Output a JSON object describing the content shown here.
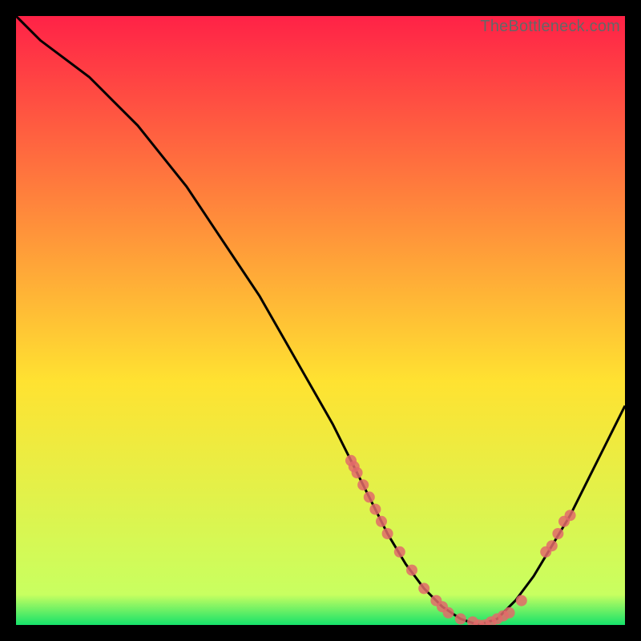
{
  "watermark": "TheBottleneck.com",
  "colors": {
    "bg": "#000000",
    "gradient_top": "#ff2247",
    "gradient_mid": "#ffe231",
    "gradient_bottom": "#16e26a",
    "curve": "#000000",
    "marker": "#e26a6a"
  },
  "chart_data": {
    "type": "line",
    "title": "",
    "xlabel": "",
    "ylabel": "",
    "xlim": [
      0,
      100
    ],
    "ylim": [
      0,
      100
    ],
    "curve": {
      "x": [
        0,
        4,
        8,
        12,
        16,
        20,
        24,
        28,
        32,
        36,
        40,
        44,
        48,
        52,
        55,
        58,
        61,
        64,
        67,
        70,
        73,
        76,
        79,
        82,
        85,
        88,
        91,
        94,
        97,
        100
      ],
      "y": [
        100,
        96,
        93,
        90,
        86,
        82,
        77,
        72,
        66,
        60,
        54,
        47,
        40,
        33,
        27,
        21,
        15,
        10,
        6,
        3,
        1,
        0,
        1,
        4,
        8,
        13,
        18,
        24,
        30,
        36
      ]
    },
    "markers": {
      "x": [
        55,
        55.5,
        56,
        57,
        58,
        59,
        60,
        61,
        63,
        65,
        67,
        69,
        70,
        71,
        73,
        75,
        76,
        77,
        78,
        79,
        80,
        81,
        83,
        87,
        88,
        89,
        90,
        91
      ],
      "y": [
        27,
        26,
        25,
        23,
        21,
        19,
        17,
        15,
        12,
        9,
        6,
        4,
        3,
        2,
        1,
        0.5,
        0,
        0,
        0.5,
        1,
        1.5,
        2,
        4,
        12,
        13,
        15,
        17,
        18
      ]
    }
  }
}
